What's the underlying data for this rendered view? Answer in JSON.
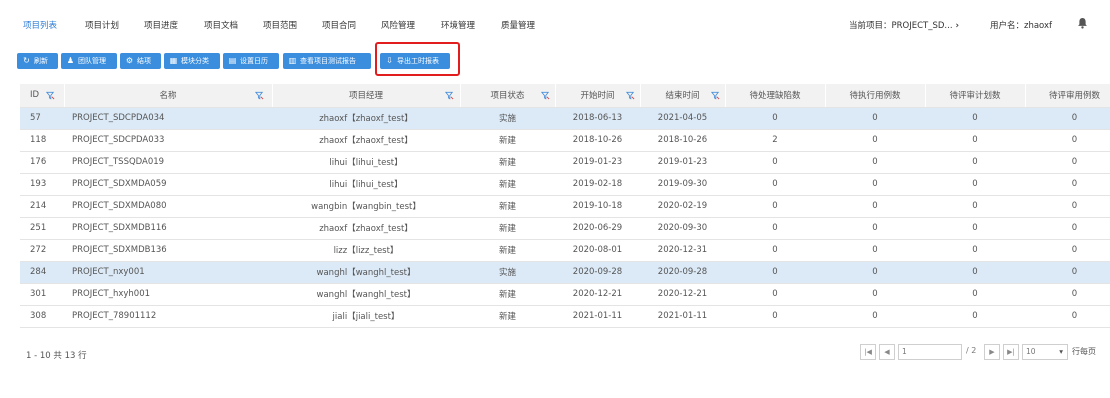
{
  "nav": {
    "tabs": [
      {
        "label": "项目列表",
        "active": true
      },
      {
        "label": "项目计划"
      },
      {
        "label": "项目进度"
      },
      {
        "label": "项目文档"
      },
      {
        "label": "项目范围"
      },
      {
        "label": "项目合同"
      },
      {
        "label": "风险管理"
      },
      {
        "label": "环境管理"
      },
      {
        "label": "质量管理"
      }
    ],
    "current_project": "当前项目：PROJECT_SD...",
    "project_chevron": "›",
    "user": "用户名：zhaoxf",
    "bell_icon": "bell-icon"
  },
  "toolbar": {
    "buttons": [
      {
        "label": "刷新",
        "icon": "refresh-icon"
      },
      {
        "label": "团队管理",
        "icon": "team-icon"
      },
      {
        "label": "结项",
        "icon": "gear-icon"
      },
      {
        "label": "模块分类",
        "icon": "grid-icon"
      },
      {
        "label": "设置日历",
        "icon": "calendar-icon"
      },
      {
        "label": "查看项目测试报告",
        "icon": "bar-chart-icon"
      },
      {
        "label": "导出工时报表",
        "icon": "export-icon"
      }
    ],
    "accent": "#3b8ede",
    "highlight": "#e21d1d"
  },
  "table": {
    "columns": [
      "ID",
      "名称",
      "项目经理",
      "项目状态",
      "开始时间",
      "结束时间",
      "待处理缺陷数",
      "待执行用例数",
      "待评审计划数",
      "待评审用例数"
    ],
    "rows": [
      {
        "id": "57",
        "name": "PROJECT_SDCPDA034",
        "manager": "zhaoxf【zhaoxf_test】",
        "status": "实施",
        "start": "2018-06-13",
        "end": "2021-04-05",
        "defects": "0",
        "cases": "0",
        "plans": "0",
        "reviews": "0",
        "selected": true
      },
      {
        "id": "118",
        "name": "PROJECT_SDCPDA033",
        "manager": "zhaoxf【zhaoxf_test】",
        "status": "新建",
        "start": "2018-10-26",
        "end": "2018-10-26",
        "defects": "2",
        "cases": "0",
        "plans": "0",
        "reviews": "0"
      },
      {
        "id": "176",
        "name": "PROJECT_TSSQDA019",
        "manager": "lihui【lihui_test】",
        "status": "新建",
        "start": "2019-01-23",
        "end": "2019-01-23",
        "defects": "0",
        "cases": "0",
        "plans": "0",
        "reviews": "0"
      },
      {
        "id": "193",
        "name": "PROJECT_SDXMDA059",
        "manager": "lihui【lihui_test】",
        "status": "新建",
        "start": "2019-02-18",
        "end": "2019-09-30",
        "defects": "0",
        "cases": "0",
        "plans": "0",
        "reviews": "0"
      },
      {
        "id": "214",
        "name": "PROJECT_SDXMDA080",
        "manager": "wangbin【wangbin_test】",
        "status": "新建",
        "start": "2019-10-18",
        "end": "2020-02-19",
        "defects": "0",
        "cases": "0",
        "plans": "0",
        "reviews": "0"
      },
      {
        "id": "251",
        "name": "PROJECT_SDXMDB116",
        "manager": "zhaoxf【zhaoxf_test】",
        "status": "新建",
        "start": "2020-06-29",
        "end": "2020-09-30",
        "defects": "0",
        "cases": "0",
        "plans": "0",
        "reviews": "0"
      },
      {
        "id": "272",
        "name": "PROJECT_SDXMDB136",
        "manager": "lizz【lizz_test】",
        "status": "新建",
        "start": "2020-08-01",
        "end": "2020-12-31",
        "defects": "0",
        "cases": "0",
        "plans": "0",
        "reviews": "0"
      },
      {
        "id": "284",
        "name": "PROJECT_nxy001",
        "manager": "wanghl【wanghl_test】",
        "status": "实施",
        "start": "2020-09-28",
        "end": "2020-09-28",
        "defects": "0",
        "cases": "0",
        "plans": "0",
        "reviews": "0",
        "selected": true
      },
      {
        "id": "301",
        "name": "PROJECT_hxyh001",
        "manager": "wanghl【wanghl_test】",
        "status": "新建",
        "start": "2020-12-21",
        "end": "2020-12-21",
        "defects": "0",
        "cases": "0",
        "plans": "0",
        "reviews": "0"
      },
      {
        "id": "308",
        "name": "PROJECT_78901112",
        "manager": "jiali【jiali_test】",
        "status": "新建",
        "start": "2021-01-11",
        "end": "2021-01-11",
        "defects": "0",
        "cases": "0",
        "plans": "0",
        "reviews": "0"
      }
    ],
    "selected_color": "#dceaf7"
  },
  "footer": {
    "summary": "1 - 10 共 13 行",
    "page_value": "1",
    "page_total": "/ 2",
    "page_size": "10",
    "per_page_label": "行每页",
    "first": "|◀",
    "prev": "◀",
    "next": "▶",
    "last": "▶|",
    "dropdown": "▾"
  }
}
